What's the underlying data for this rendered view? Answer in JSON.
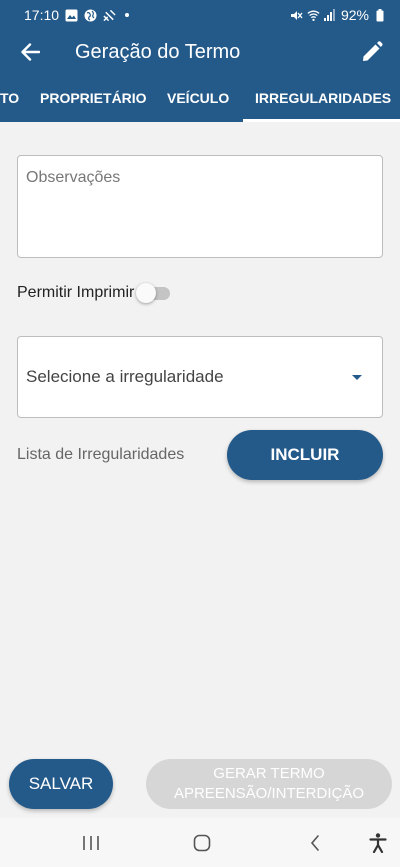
{
  "status_bar": {
    "time": "17:10",
    "battery": "92%",
    "icons": [
      "gallery-icon",
      "globe-icon",
      "satellite-icon",
      "notification-dot",
      "mute-icon",
      "wifi-icon",
      "signal-icon",
      "battery-icon"
    ]
  },
  "app_bar": {
    "title": "Geração do Termo",
    "back_icon": "arrow-left-icon",
    "edit_icon": "pencil-icon"
  },
  "tabs": [
    {
      "label": "TO",
      "selected": false
    },
    {
      "label": "PROPRIETÁRIO",
      "selected": false
    },
    {
      "label": "VEÍCULO",
      "selected": false
    },
    {
      "label": "IRREGULARIDADES",
      "selected": true
    }
  ],
  "form": {
    "observacoes": {
      "value": "",
      "placeholder": "Observações"
    },
    "permitir_imprimir": {
      "label": "Permitir Imprimir",
      "checked": false
    },
    "irregularidade_select": {
      "value": "Selecione a irregularidade"
    },
    "list_label": "Lista de Irregularidades",
    "incluir_label": "INCLUIR"
  },
  "footer": {
    "salvar_label": "SALVAR",
    "gerar_line1": "GERAR TERMO",
    "gerar_line2": "APREENSÃO/INTERDIÇÃO"
  },
  "nav_bar": {
    "icons": [
      "recent-apps-icon",
      "home-icon",
      "back-icon",
      "accessibility-icon"
    ]
  },
  "colors": {
    "primary": "#245a8a",
    "background": "#f2f2f2",
    "disabled_button": "#d6d6d6"
  }
}
